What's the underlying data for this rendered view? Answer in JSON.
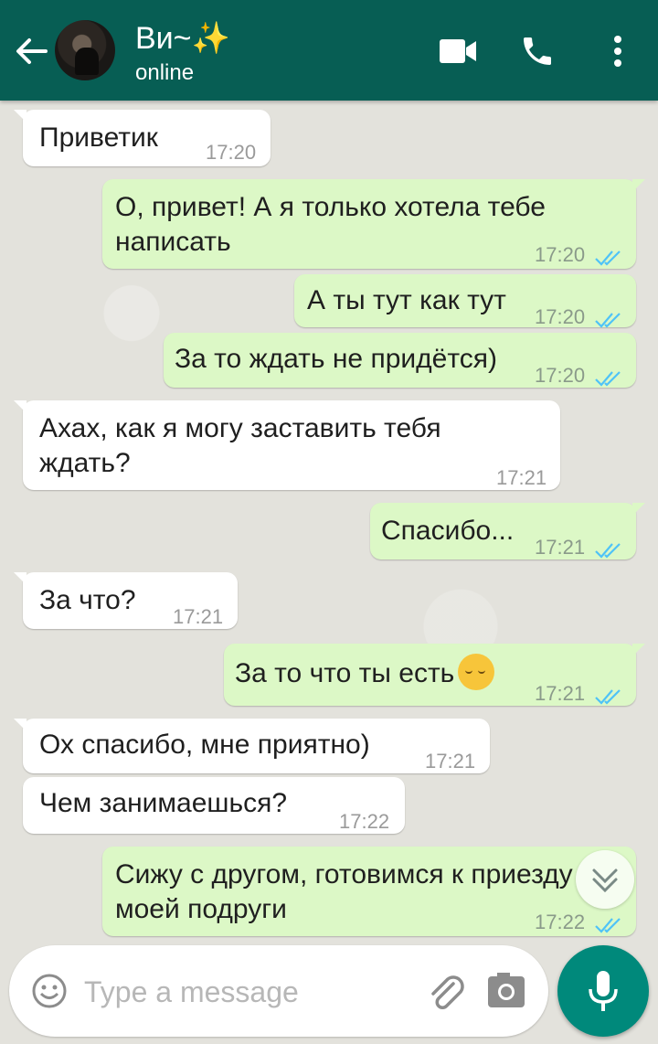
{
  "header": {
    "contact_name": "Ви~✨",
    "status": "online",
    "colors": {
      "bar": "#075e54",
      "text": "#ffffff"
    },
    "icons": [
      "back-arrow-icon",
      "video-call-icon",
      "phone-icon",
      "more-vert-icon"
    ]
  },
  "messages": [
    {
      "direction": "in",
      "text": "Приветик",
      "time": "17:20"
    },
    {
      "direction": "out",
      "text": "О, привет! А я только хотела тебе\nнаписать",
      "time": "17:20",
      "ticks": "read"
    },
    {
      "direction": "out",
      "text": "А ты тут как тут",
      "time": "17:20",
      "ticks": "read"
    },
    {
      "direction": "out",
      "text": "За то ждать не придётся)",
      "time": "17:20",
      "ticks": "read"
    },
    {
      "direction": "in",
      "text": "Ахах, как я могу заставить тебя\nждать?",
      "time": "17:21"
    },
    {
      "direction": "out",
      "text": "Спасибо...",
      "time": "17:21",
      "ticks": "read"
    },
    {
      "direction": "in",
      "text": "За что?",
      "time": "17:21"
    },
    {
      "direction": "out",
      "text": "За то что ты есть",
      "emoji": "relieved-face",
      "time": "17:21",
      "ticks": "read"
    },
    {
      "direction": "in",
      "text": "Ох спасибо, мне приятно)",
      "time": "17:21"
    },
    {
      "direction": "in",
      "text": "Чем занимаешься?",
      "time": "17:22"
    },
    {
      "direction": "out",
      "text": "Сижу с другом, готовимся к приезду\nмоей подруги",
      "time": "17:22",
      "ticks": "read"
    }
  ],
  "composer": {
    "placeholder": "Type a message",
    "icons": [
      "emoji-icon",
      "attach-icon",
      "camera-icon",
      "mic-icon"
    ],
    "accent": "#00897b"
  },
  "colors": {
    "incoming_bubble": "#ffffff",
    "outgoing_bubble": "#dcf8c6",
    "read_ticks": "#4fc3f7"
  }
}
